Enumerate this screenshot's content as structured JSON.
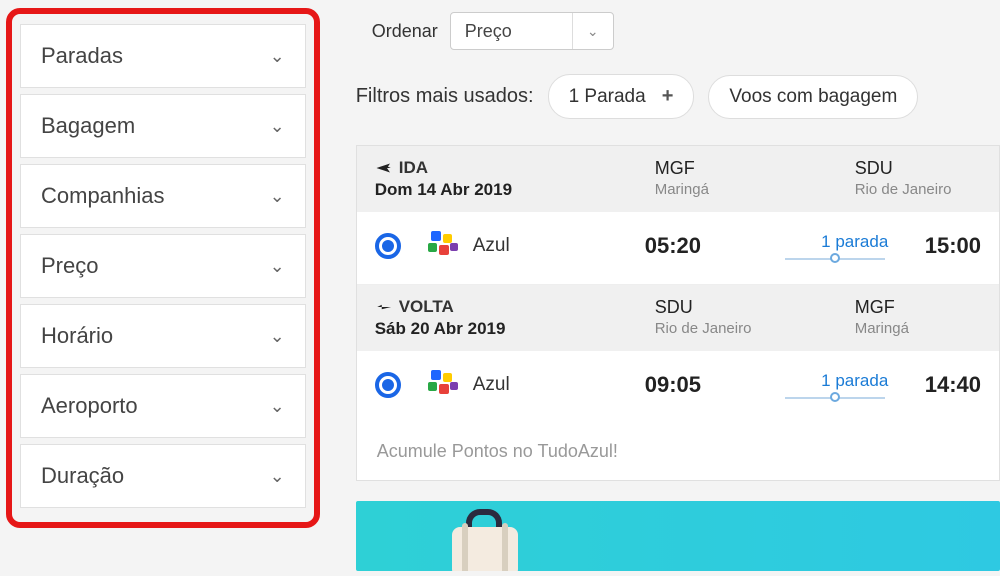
{
  "sidebar": {
    "filters": [
      {
        "label": "Paradas"
      },
      {
        "label": "Bagagem"
      },
      {
        "label": "Companhias"
      },
      {
        "label": "Preço"
      },
      {
        "label": "Horário"
      },
      {
        "label": "Aeroporto"
      },
      {
        "label": "Duração"
      }
    ]
  },
  "sort": {
    "label": "Ordenar",
    "selected": "Preço"
  },
  "usedFilters": {
    "label": "Filtros mais usados:",
    "chips": [
      {
        "label": "1 Parada"
      },
      {
        "label": "Voos com bagagem"
      }
    ]
  },
  "result": {
    "ida": {
      "tag": "IDA",
      "date": "Dom 14 Abr 2019",
      "from": {
        "code": "MGF",
        "city": "Maringá"
      },
      "to": {
        "code": "SDU",
        "city": "Rio de Janeiro"
      },
      "airline": "Azul",
      "depart": "05:20",
      "stops": "1 parada",
      "arrive": "15:00"
    },
    "volta": {
      "tag": "VOLTA",
      "date": "Sáb 20 Abr 2019",
      "from": {
        "code": "SDU",
        "city": "Rio de Janeiro"
      },
      "to": {
        "code": "MGF",
        "city": "Maringá"
      },
      "airline": "Azul",
      "depart": "09:05",
      "stops": "1 parada",
      "arrive": "14:40"
    },
    "promo": "Acumule Pontos no TudoAzul!"
  }
}
